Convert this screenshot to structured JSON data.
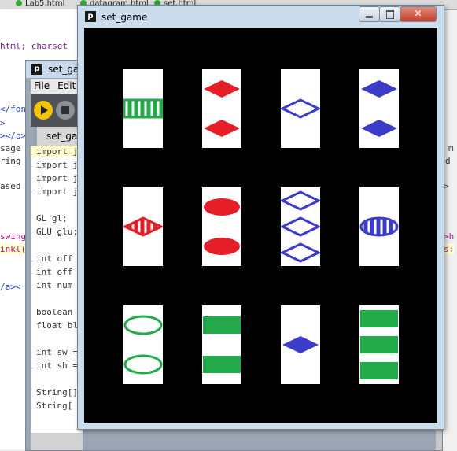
{
  "browser_tabs": [
    {
      "label": "Lab5.html"
    },
    {
      "label": "datagram.html"
    },
    {
      "label": "set.html"
    }
  ],
  "bg_left_lines": [
    "html; charset",
    "</font>",
    ">",
    "></p>",
    "sage",
    "ring",
    "ased",
    "swing",
    "inkl(",
    "/a><"
  ],
  "bg_right_lines": [
    "m",
    "d",
    ">",
    ">h",
    "s:"
  ],
  "ide": {
    "title": "set_ga",
    "menu": [
      "File",
      "Edit"
    ],
    "tab": "set_ga",
    "code": [
      "import j",
      "import j",
      "import j",
      "import j",
      "",
      "GL gl;",
      "GLU glu;",
      "",
      "int off",
      "int off",
      "int num",
      "",
      "boolean",
      "float bl",
      "",
      "int sw =",
      "int sh =",
      "",
      "String[]",
      "String["
    ]
  },
  "set_game": {
    "title": "set_game",
    "icon": "processing-icon",
    "controls": [
      "minimize-icon",
      "maximize-icon",
      "close-icon"
    ],
    "colors": {
      "red": "#e61e28",
      "green": "#22aa4b",
      "blue": "#3c3cc8",
      "background": "#000000",
      "card": "#ffffff"
    },
    "cards": [
      {
        "count": 1,
        "shape": "rectangle",
        "color": "green",
        "fill": "striped"
      },
      {
        "count": 2,
        "shape": "diamond",
        "color": "red",
        "fill": "solid"
      },
      {
        "count": 1,
        "shape": "diamond",
        "color": "blue",
        "fill": "empty"
      },
      {
        "count": 2,
        "shape": "diamond",
        "color": "blue",
        "fill": "solid"
      },
      {
        "count": 1,
        "shape": "diamond",
        "color": "red",
        "fill": "striped"
      },
      {
        "count": 2,
        "shape": "oval",
        "color": "red",
        "fill": "solid"
      },
      {
        "count": 3,
        "shape": "diamond",
        "color": "blue",
        "fill": "empty"
      },
      {
        "count": 1,
        "shape": "oval",
        "color": "blue",
        "fill": "striped"
      },
      {
        "count": 2,
        "shape": "oval",
        "color": "green",
        "fill": "empty"
      },
      {
        "count": 2,
        "shape": "rectangle",
        "color": "green",
        "fill": "solid"
      },
      {
        "count": 1,
        "shape": "diamond",
        "color": "blue",
        "fill": "solid"
      },
      {
        "count": 3,
        "shape": "rectangle",
        "color": "green",
        "fill": "solid"
      }
    ]
  }
}
